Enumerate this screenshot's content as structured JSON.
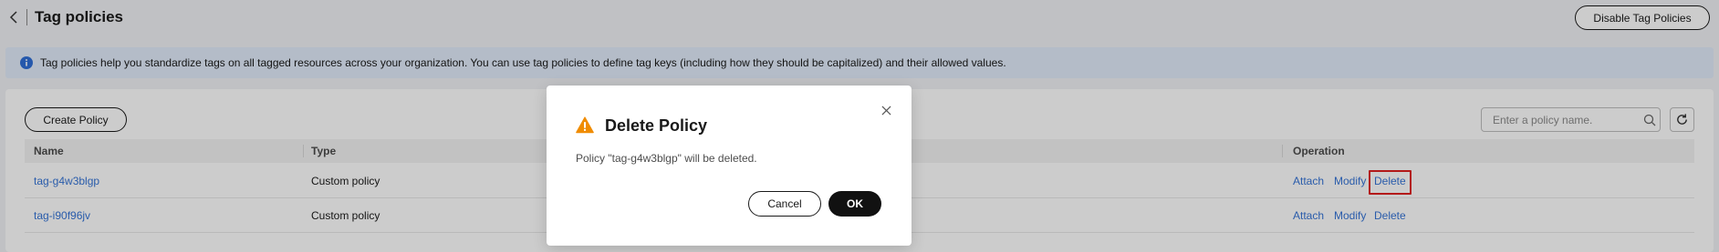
{
  "header": {
    "title": "Tag policies",
    "disable_button": "Disable Tag Policies"
  },
  "banner": {
    "icon": "info-icon",
    "text": "Tag policies help you standardize tags on all tagged resources across your organization. You can use tag policies to define tag keys (including how they should be capitalized) and their allowed values."
  },
  "toolbar": {
    "create_button": "Create Policy",
    "search_placeholder": "Enter a policy name.",
    "search_value": ""
  },
  "table": {
    "columns": [
      "Name",
      "Type",
      "Operation"
    ],
    "rows": [
      {
        "name": "tag-g4w3blgp",
        "type": "Custom policy",
        "actions": [
          "Attach",
          "Modify",
          "Delete"
        ]
      },
      {
        "name": "tag-i90f96jv",
        "type": "Custom policy",
        "actions": [
          "Attach",
          "Modify",
          "Delete"
        ]
      }
    ]
  },
  "dialog": {
    "title": "Delete Policy",
    "message": "Policy \"tag-g4w3blgp\" will be deleted.",
    "cancel": "Cancel",
    "ok": "OK"
  },
  "colors": {
    "link": "#3574d6",
    "banner_bg": "#e1ecfa",
    "warning": "#f08c00",
    "highlight": "#e02020",
    "primary_button": "#111111"
  }
}
